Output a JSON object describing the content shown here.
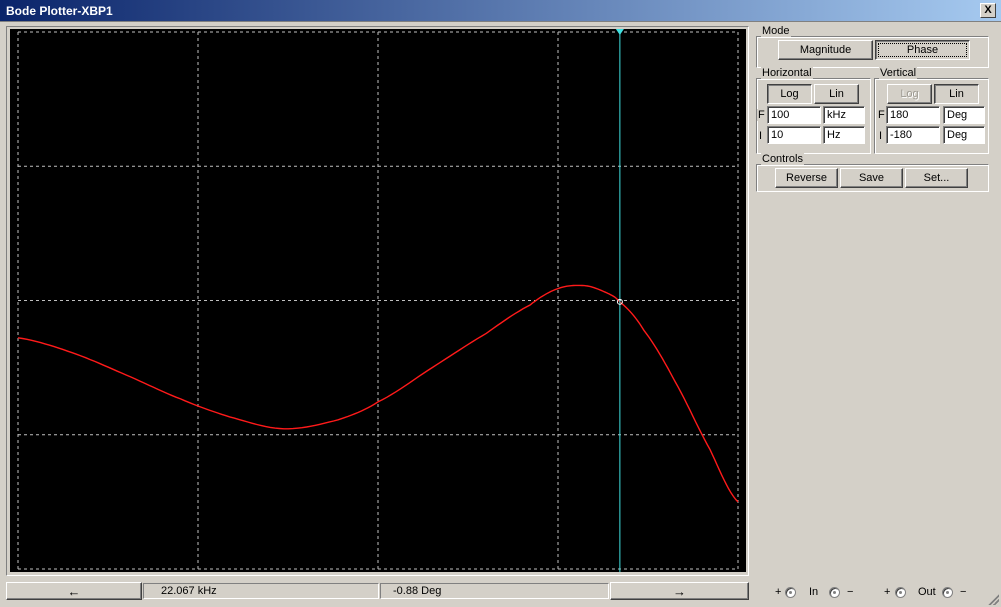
{
  "window": {
    "title": "Bode Plotter-XBP1",
    "close_label": "X"
  },
  "mode": {
    "title": "Mode",
    "magnitude_label": "Magnitude",
    "phase_label": "Phase",
    "selected": "Phase"
  },
  "horizontal": {
    "title": "Horizontal",
    "log_label": "Log",
    "lin_label": "Lin",
    "selected": "Log",
    "f_label": "F",
    "i_label": "I",
    "f_value": "100",
    "f_unit": "kHz",
    "i_value": "10",
    "i_unit": "Hz"
  },
  "vertical": {
    "title": "Vertical",
    "log_label": "Log",
    "lin_label": "Lin",
    "selected": "Lin",
    "f_label": "F",
    "i_label": "I",
    "f_value": "180",
    "f_unit": "Deg",
    "i_value": "-180",
    "i_unit": "Deg"
  },
  "controls": {
    "title": "Controls",
    "reverse_label": "Reverse",
    "save_label": "Save",
    "set_label": "Set..."
  },
  "status": {
    "left_arrow": "←",
    "right_arrow": "→",
    "frequency_readout": "22.067 kHz",
    "value_readout": "-0.88 Deg"
  },
  "terminals": {
    "in_label": "In",
    "out_label": "Out",
    "plus": "+",
    "minus": "−"
  },
  "colors": {
    "plot_background": "#000000",
    "grid": "#bfbfbf",
    "trace": "#ff1a1a",
    "cursor": "#40e0e0"
  },
  "chart_data": {
    "type": "line",
    "x_scale": "log",
    "xlim_hz": [
      10,
      100000
    ],
    "ylim": [
      -180,
      180
    ],
    "y_unit": "Deg",
    "grid": true,
    "cursor": {
      "x_hz": 22067,
      "y": -0.88
    },
    "series": [
      {
        "x_hz": [
          10,
          20,
          40,
          80,
          150,
          300,
          600,
          1000,
          2000,
          4000,
          7000,
          10000,
          14000,
          18000,
          22067,
          30000,
          45000,
          70000,
          100000
        ],
        "y": [
          -25,
          -35,
          -50,
          -66,
          -78,
          -86,
          -80,
          -68,
          -45,
          -22,
          -3,
          8,
          10,
          6,
          -1,
          -20,
          -55,
          -100,
          -135
        ]
      }
    ]
  }
}
